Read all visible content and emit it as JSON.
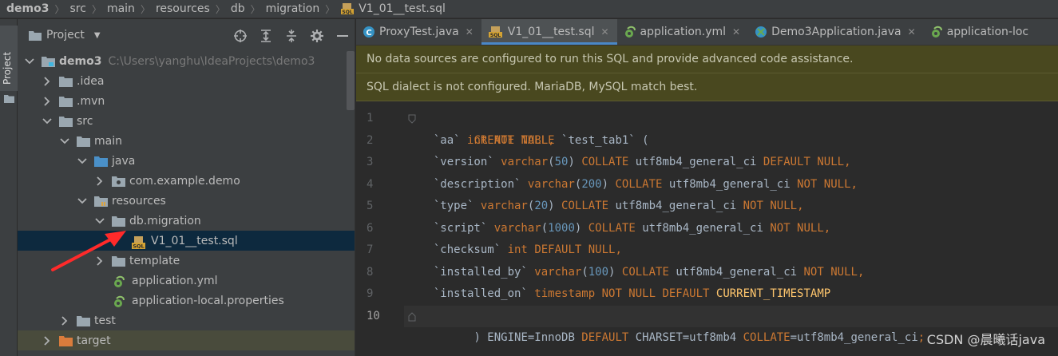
{
  "breadcrumb": [
    "demo3",
    "src",
    "main",
    "resources",
    "db",
    "migration",
    "V1_01__test.sql"
  ],
  "project_panel": {
    "title": "Project"
  },
  "toolstrip": {
    "label": "Project"
  },
  "tree": {
    "root_name": "demo3",
    "root_path": "C:\\Users\\yanghu\\IdeaProjects\\demo3",
    "idea": ".idea",
    "mvn": ".mvn",
    "src": "src",
    "main": "main",
    "java": "java",
    "package": "com.example.demo",
    "resources": "resources",
    "db_migration": "db.migration",
    "sql_file": "V1_01__test.sql",
    "template": "template",
    "app_yml": "application.yml",
    "app_local": "application-local.properties",
    "test": "test",
    "target": "target"
  },
  "tabs": [
    {
      "label": "ProxyTest.java"
    },
    {
      "label": "V1_01__test.sql"
    },
    {
      "label": "application.yml"
    },
    {
      "label": "Demo3Application.java"
    },
    {
      "label": "application-loc"
    }
  ],
  "banners": {
    "datasource": "No data sources are configured to run this SQL and provide advanced code assistance.",
    "dialect": "SQL dialect is not configured. MariaDB, MySQL match best."
  },
  "line_numbers": [
    "1",
    "2",
    "3",
    "4",
    "5",
    "6",
    "7",
    "8",
    "9",
    "10"
  ],
  "code": {
    "l1": [
      "CREATE TABLE",
      " `test_tab1` ("
    ],
    "l2": [
      "  `aa` ",
      "int",
      " ",
      "NOT NULL",
      ","
    ],
    "l3": [
      "  `version` ",
      "varchar",
      "(",
      "50",
      ") ",
      "COLLATE",
      " utf8mb4_general_ci ",
      "DEFAULT NULL",
      ","
    ],
    "l4": [
      "  `description` ",
      "varchar",
      "(",
      "200",
      ") ",
      "COLLATE",
      " utf8mb4_general_ci ",
      "NOT NULL",
      ","
    ],
    "l5": [
      "  `type` ",
      "varchar",
      "(",
      "20",
      ") ",
      "COLLATE",
      " utf8mb4_general_ci ",
      "NOT NULL",
      ","
    ],
    "l6": [
      "  `script` ",
      "varchar",
      "(",
      "1000",
      ") ",
      "COLLATE",
      " utf8mb4_general_ci ",
      "NOT NULL",
      ","
    ],
    "l7": [
      "  `checksum` ",
      "int",
      " ",
      "DEFAULT NULL",
      ","
    ],
    "l8": [
      "  `installed_by` ",
      "varchar",
      "(",
      "100",
      ") ",
      "COLLATE",
      " utf8mb4_general_ci ",
      "NOT NULL",
      ","
    ],
    "l9": [
      "  `installed_on` ",
      "timestamp",
      " ",
      "NOT NULL DEFAULT",
      " ",
      "CURRENT_TIMESTAMP"
    ],
    "l10": [
      ") ENGINE=InnoDB ",
      "DEFAULT",
      " CHARSET=utf8mb4 ",
      "COLLATE",
      "=utf8mb4_general_ci",
      ";"
    ]
  },
  "watermark": "CSDN @晨曦话java",
  "colors": {
    "keyword": "#cc7832",
    "number": "#6897bb",
    "function": "#ffc66d",
    "text": "#a9b7c6",
    "banner_bg": "#49481f",
    "selection": "#0d293e",
    "annotation_arrow": "#ff2a2a"
  }
}
